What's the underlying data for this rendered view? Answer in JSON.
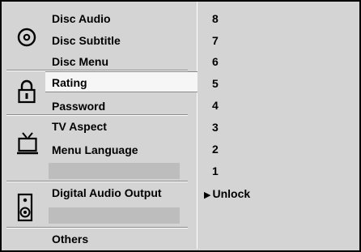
{
  "left_menu": {
    "disc": {
      "items": [
        "Disc Audio",
        "Disc Subtitle",
        "Disc Menu"
      ],
      "icon": "disc-icon"
    },
    "lock": {
      "items": [
        "Rating",
        "Password"
      ],
      "icon": "lock-icon",
      "selected": "Rating"
    },
    "tv": {
      "items": [
        "TV Aspect",
        "Menu Language"
      ],
      "icon": "tv-icon"
    },
    "audio": {
      "items": [
        "Digital Audio Output"
      ],
      "icon": "speaker-icon"
    },
    "others": {
      "items": [
        "Others"
      ]
    }
  },
  "rating_options": {
    "levels": [
      "8",
      "7",
      "6",
      "5",
      "4",
      "3",
      "2",
      "1"
    ],
    "unlock_label": "Unlock",
    "current": "Unlock"
  },
  "colors": {
    "panel_bg": "#d4d4d4",
    "highlight_bg": "#f6f6f6",
    "text": "#000000"
  }
}
